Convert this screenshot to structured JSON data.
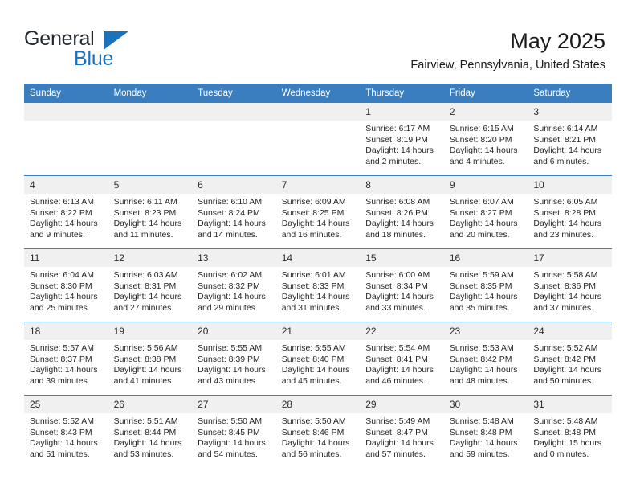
{
  "brand": {
    "line1": "General",
    "line2": "Blue",
    "triangle_color": "#1a72bd"
  },
  "header": {
    "title": "May 2025",
    "subtitle": "Fairview, Pennsylvania, United States",
    "accent_color": "#3a7ebf"
  },
  "weekday_headers": [
    "Sunday",
    "Monday",
    "Tuesday",
    "Wednesday",
    "Thursday",
    "Friday",
    "Saturday"
  ],
  "labels": {
    "sunrise": "Sunrise:",
    "sunset": "Sunset:",
    "daylight": "Daylight:"
  },
  "weeks": [
    [
      {
        "day": "",
        "empty": true
      },
      {
        "day": "",
        "empty": true
      },
      {
        "day": "",
        "empty": true
      },
      {
        "day": "",
        "empty": true
      },
      {
        "day": "1",
        "sunrise": "Sunrise: 6:17 AM",
        "sunset": "Sunset: 8:19 PM",
        "daylight1": "Daylight: 14 hours",
        "daylight2": "and 2 minutes."
      },
      {
        "day": "2",
        "sunrise": "Sunrise: 6:15 AM",
        "sunset": "Sunset: 8:20 PM",
        "daylight1": "Daylight: 14 hours",
        "daylight2": "and 4 minutes."
      },
      {
        "day": "3",
        "sunrise": "Sunrise: 6:14 AM",
        "sunset": "Sunset: 8:21 PM",
        "daylight1": "Daylight: 14 hours",
        "daylight2": "and 6 minutes."
      }
    ],
    [
      {
        "day": "4",
        "sunrise": "Sunrise: 6:13 AM",
        "sunset": "Sunset: 8:22 PM",
        "daylight1": "Daylight: 14 hours",
        "daylight2": "and 9 minutes."
      },
      {
        "day": "5",
        "sunrise": "Sunrise: 6:11 AM",
        "sunset": "Sunset: 8:23 PM",
        "daylight1": "Daylight: 14 hours",
        "daylight2": "and 11 minutes."
      },
      {
        "day": "6",
        "sunrise": "Sunrise: 6:10 AM",
        "sunset": "Sunset: 8:24 PM",
        "daylight1": "Daylight: 14 hours",
        "daylight2": "and 14 minutes."
      },
      {
        "day": "7",
        "sunrise": "Sunrise: 6:09 AM",
        "sunset": "Sunset: 8:25 PM",
        "daylight1": "Daylight: 14 hours",
        "daylight2": "and 16 minutes."
      },
      {
        "day": "8",
        "sunrise": "Sunrise: 6:08 AM",
        "sunset": "Sunset: 8:26 PM",
        "daylight1": "Daylight: 14 hours",
        "daylight2": "and 18 minutes."
      },
      {
        "day": "9",
        "sunrise": "Sunrise: 6:07 AM",
        "sunset": "Sunset: 8:27 PM",
        "daylight1": "Daylight: 14 hours",
        "daylight2": "and 20 minutes."
      },
      {
        "day": "10",
        "sunrise": "Sunrise: 6:05 AM",
        "sunset": "Sunset: 8:28 PM",
        "daylight1": "Daylight: 14 hours",
        "daylight2": "and 23 minutes."
      }
    ],
    [
      {
        "day": "11",
        "sunrise": "Sunrise: 6:04 AM",
        "sunset": "Sunset: 8:30 PM",
        "daylight1": "Daylight: 14 hours",
        "daylight2": "and 25 minutes."
      },
      {
        "day": "12",
        "sunrise": "Sunrise: 6:03 AM",
        "sunset": "Sunset: 8:31 PM",
        "daylight1": "Daylight: 14 hours",
        "daylight2": "and 27 minutes."
      },
      {
        "day": "13",
        "sunrise": "Sunrise: 6:02 AM",
        "sunset": "Sunset: 8:32 PM",
        "daylight1": "Daylight: 14 hours",
        "daylight2": "and 29 minutes."
      },
      {
        "day": "14",
        "sunrise": "Sunrise: 6:01 AM",
        "sunset": "Sunset: 8:33 PM",
        "daylight1": "Daylight: 14 hours",
        "daylight2": "and 31 minutes."
      },
      {
        "day": "15",
        "sunrise": "Sunrise: 6:00 AM",
        "sunset": "Sunset: 8:34 PM",
        "daylight1": "Daylight: 14 hours",
        "daylight2": "and 33 minutes."
      },
      {
        "day": "16",
        "sunrise": "Sunrise: 5:59 AM",
        "sunset": "Sunset: 8:35 PM",
        "daylight1": "Daylight: 14 hours",
        "daylight2": "and 35 minutes."
      },
      {
        "day": "17",
        "sunrise": "Sunrise: 5:58 AM",
        "sunset": "Sunset: 8:36 PM",
        "daylight1": "Daylight: 14 hours",
        "daylight2": "and 37 minutes."
      }
    ],
    [
      {
        "day": "18",
        "sunrise": "Sunrise: 5:57 AM",
        "sunset": "Sunset: 8:37 PM",
        "daylight1": "Daylight: 14 hours",
        "daylight2": "and 39 minutes."
      },
      {
        "day": "19",
        "sunrise": "Sunrise: 5:56 AM",
        "sunset": "Sunset: 8:38 PM",
        "daylight1": "Daylight: 14 hours",
        "daylight2": "and 41 minutes."
      },
      {
        "day": "20",
        "sunrise": "Sunrise: 5:55 AM",
        "sunset": "Sunset: 8:39 PM",
        "daylight1": "Daylight: 14 hours",
        "daylight2": "and 43 minutes."
      },
      {
        "day": "21",
        "sunrise": "Sunrise: 5:55 AM",
        "sunset": "Sunset: 8:40 PM",
        "daylight1": "Daylight: 14 hours",
        "daylight2": "and 45 minutes."
      },
      {
        "day": "22",
        "sunrise": "Sunrise: 5:54 AM",
        "sunset": "Sunset: 8:41 PM",
        "daylight1": "Daylight: 14 hours",
        "daylight2": "and 46 minutes."
      },
      {
        "day": "23",
        "sunrise": "Sunrise: 5:53 AM",
        "sunset": "Sunset: 8:42 PM",
        "daylight1": "Daylight: 14 hours",
        "daylight2": "and 48 minutes."
      },
      {
        "day": "24",
        "sunrise": "Sunrise: 5:52 AM",
        "sunset": "Sunset: 8:42 PM",
        "daylight1": "Daylight: 14 hours",
        "daylight2": "and 50 minutes."
      }
    ],
    [
      {
        "day": "25",
        "sunrise": "Sunrise: 5:52 AM",
        "sunset": "Sunset: 8:43 PM",
        "daylight1": "Daylight: 14 hours",
        "daylight2": "and 51 minutes."
      },
      {
        "day": "26",
        "sunrise": "Sunrise: 5:51 AM",
        "sunset": "Sunset: 8:44 PM",
        "daylight1": "Daylight: 14 hours",
        "daylight2": "and 53 minutes."
      },
      {
        "day": "27",
        "sunrise": "Sunrise: 5:50 AM",
        "sunset": "Sunset: 8:45 PM",
        "daylight1": "Daylight: 14 hours",
        "daylight2": "and 54 minutes."
      },
      {
        "day": "28",
        "sunrise": "Sunrise: 5:50 AM",
        "sunset": "Sunset: 8:46 PM",
        "daylight1": "Daylight: 14 hours",
        "daylight2": "and 56 minutes."
      },
      {
        "day": "29",
        "sunrise": "Sunrise: 5:49 AM",
        "sunset": "Sunset: 8:47 PM",
        "daylight1": "Daylight: 14 hours",
        "daylight2": "and 57 minutes."
      },
      {
        "day": "30",
        "sunrise": "Sunrise: 5:48 AM",
        "sunset": "Sunset: 8:48 PM",
        "daylight1": "Daylight: 14 hours",
        "daylight2": "and 59 minutes."
      },
      {
        "day": "31",
        "sunrise": "Sunrise: 5:48 AM",
        "sunset": "Sunset: 8:48 PM",
        "daylight1": "Daylight: 15 hours",
        "daylight2": "and 0 minutes."
      }
    ]
  ]
}
